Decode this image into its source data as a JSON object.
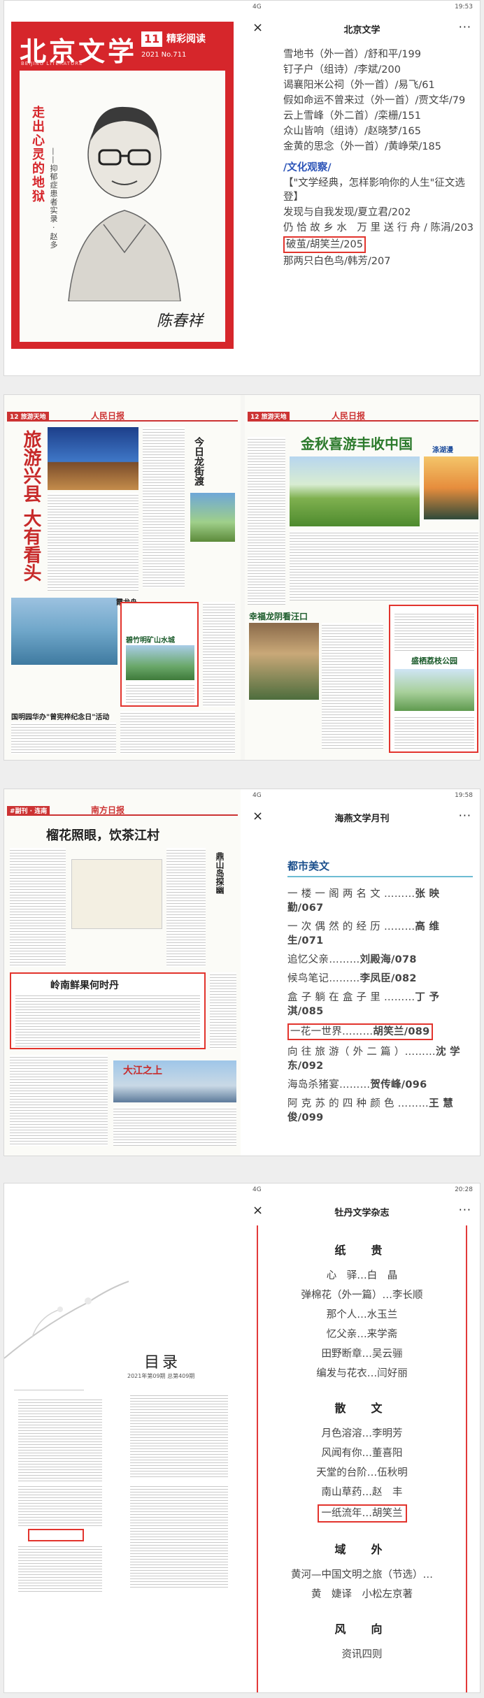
{
  "panel1": {
    "cover": {
      "logo": "北京文学",
      "logo_en": "BEIJING LITERATURE",
      "issue_no": "11",
      "issue_name": "精彩阅读",
      "issue_year": "2021 No.711",
      "vertical_title": "走出心灵的地狱",
      "vertical_sub": "——抑郁症患者实录 · 赵多",
      "signature": "陈春祥"
    },
    "status": {
      "time": "19:53",
      "signal": "4G"
    },
    "nav": {
      "close": "×",
      "title": "北京文学",
      "more": "···"
    },
    "entries": [
      "雪地书（外一首）/舒和平/199",
      "钉子户（组诗）/李斌/200",
      "谒襄阳米公祠（外一首）/易飞/61",
      "假如命运不曾来过（外一首）/贾文华/79",
      "云上雪峰（外二首）/栾栅/151",
      "众山皆响（组诗）/赵晓梦/165",
      "金黄的思念（外一首）/黄峥荣/185"
    ],
    "section": "/文化观察/",
    "entries2": [
      "【\"文学经典，怎样影响你的人生\"征文选登】",
      "发现与自我发现/夏立君/202",
      "仍 恰 故 乡 水　万 里 送 行 舟 / 陈涓/203"
    ],
    "highlight": "破茧/胡笑兰/205",
    "entries3": [
      "那两只白色鸟/韩芳/207"
    ]
  },
  "panel2": {
    "left": {
      "tag": "12 旅游天地",
      "paper": "人民日报",
      "headline": "旅游兴县 大有看头",
      "sub": "今日龙街渡",
      "box_title": "碧竹明矿山水城",
      "bottom_title": "国明园华办\"曾宪梓纪念日\"活动",
      "side_title": "霞龙舟"
    },
    "right": {
      "tag": "12 旅游天地",
      "paper": "人民日报",
      "headline": "金秋喜游丰收中国",
      "sub_left": "幸福龙阴看汪口",
      "box_title": "盛栖荔枝公园",
      "caption": "涤湖漫"
    }
  },
  "panel3": {
    "mag": {
      "tag": "#副刊 · 连南",
      "paper": "南方日报",
      "headline": "榴花照眼，饮茶江村",
      "side": "鼎山岛探幽",
      "box_title": "岭南鲜果何时丹",
      "bottom_title": "大江之上"
    },
    "status": {
      "time": "19:58",
      "signal": "4G"
    },
    "nav": {
      "close": "×",
      "title": "海燕文学月刊",
      "more": "···"
    },
    "section": "都市美文",
    "entries": [
      {
        "title": "一 楼 一 阁 两 名 文 ………",
        "author": "张 映 勤/067"
      },
      {
        "title": "一 次 偶 然 的 经 历 ………",
        "author": "高 维 生/071"
      },
      {
        "title": "追忆父亲………",
        "author": "刘殿海/078"
      },
      {
        "title": "候鸟笔记………",
        "author": "李凤臣/082"
      },
      {
        "title": "盒 子 躺 在 盒 子 里 ………",
        "author": "丁 予 淇/085"
      }
    ],
    "highlight": {
      "title": "一花一世界………",
      "author": "胡笑兰/089"
    },
    "entries2": [
      {
        "title": "向 往 旅 游（ 外 二 篇 ）………",
        "author": "沈 学 东/092"
      },
      {
        "title": "海岛杀猪宴………",
        "author": "贺传峰/096"
      },
      {
        "title": "阿 克 苏 的 四 种 颜 色 ………",
        "author": "王 慧 俊/099"
      }
    ]
  },
  "panel4": {
    "mag": {
      "title": "目录",
      "subtitle": "2021年第09期 总第409期"
    },
    "status": {
      "time": "20:28",
      "signal": "4G"
    },
    "nav": {
      "close": "×",
      "title": "牡丹文学杂志",
      "more": "···"
    },
    "sec1": "纸　贵",
    "entries1": [
      "心　驿…白　晶",
      "弹棉花（外一篇）…李长顺",
      "那个人…水玉兰",
      "忆父亲…来学斋",
      "田野断章…吴云骊",
      "编发与花衣…闫好丽"
    ],
    "sec2": "散　文",
    "entries2": [
      "月色溶溶…李明芳",
      "风闻有你…董喜阳",
      "天堂的台阶…伍秋明",
      "南山草药…赵　丰"
    ],
    "highlight": "一纸流年…胡笑兰",
    "sec3": "域　外",
    "entries3": [
      "黄河—中国文明之旅（节选）…",
      "黄　婕译　小松左京著"
    ],
    "sec4": "风　向",
    "entries4": [
      "资讯四则"
    ]
  }
}
